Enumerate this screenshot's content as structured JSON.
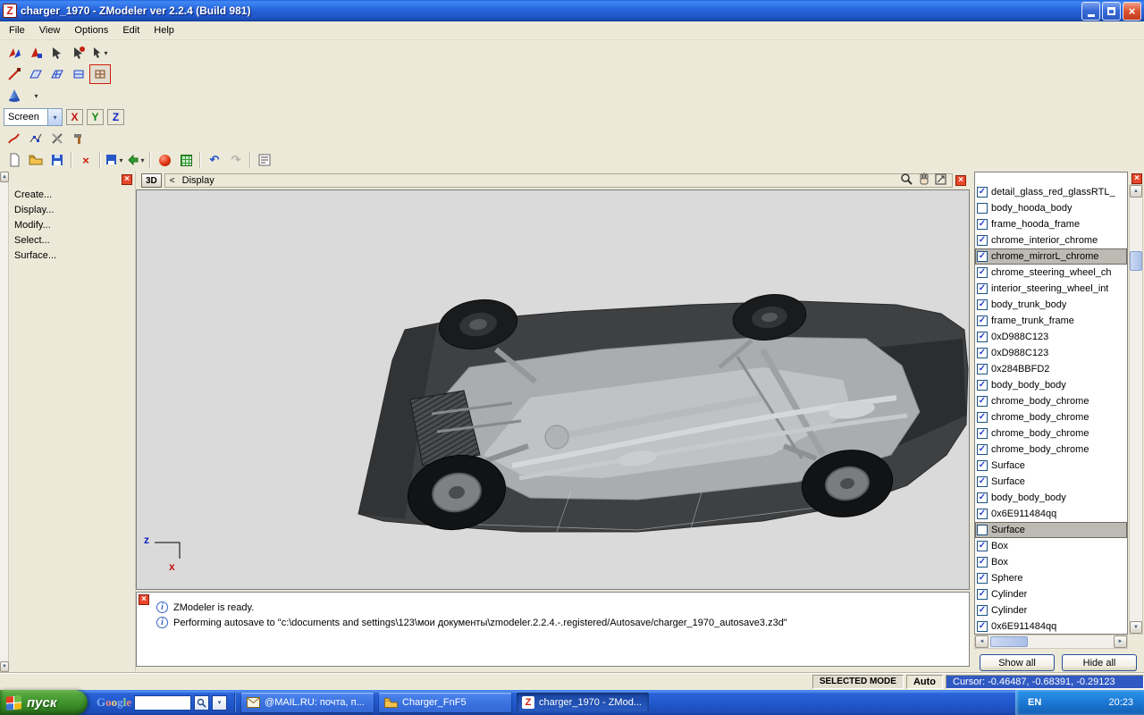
{
  "window": {
    "title": "charger_1970 - ZModeler ver 2.2.4 (Build 981)",
    "app_icon_letter": "Z"
  },
  "glyphs": {
    "close": "×",
    "dropdown": "▾",
    "up": "▲",
    "down": "▼",
    "left": "◄",
    "right": "►",
    "check": "✓",
    "undo": "↶",
    "redo": "↷",
    "info": "i",
    "delete": "×"
  },
  "menu": {
    "items": [
      {
        "label": "File"
      },
      {
        "label": "View"
      },
      {
        "label": "Options"
      },
      {
        "label": "Edit"
      },
      {
        "label": "Help"
      }
    ]
  },
  "toolbar": {
    "space_combo": {
      "value": "Screen"
    },
    "axes": {
      "x": "X",
      "y": "Y",
      "z": "Z"
    }
  },
  "left_panel": {
    "items": [
      {
        "label": "Create..."
      },
      {
        "label": "Display..."
      },
      {
        "label": "Modify..."
      },
      {
        "label": "Select..."
      },
      {
        "label": "Surface..."
      }
    ]
  },
  "viewport": {
    "mode_button": "3D",
    "back": "<",
    "title": "Display",
    "axis": {
      "z": "z",
      "x": "x"
    }
  },
  "right_panel": {
    "show_all": "Show all",
    "hide_all": "Hide all",
    "items": [
      {
        "label": "detail_glass_red_glassRTL_",
        "checked": true,
        "selected": false
      },
      {
        "label": "body_hooda_body",
        "checked": false,
        "selected": false
      },
      {
        "label": "frame_hooda_frame",
        "checked": true,
        "selected": false
      },
      {
        "label": "chrome_interior_chrome",
        "checked": true,
        "selected": false
      },
      {
        "label": "chrome_mirrorL_chrome",
        "checked": true,
        "selected": true
      },
      {
        "label": "chrome_steering_wheel_ch",
        "checked": true,
        "selected": false
      },
      {
        "label": "interior_steering_wheel_int",
        "checked": true,
        "selected": false
      },
      {
        "label": "body_trunk_body",
        "checked": true,
        "selected": false
      },
      {
        "label": "frame_trunk_frame",
        "checked": true,
        "selected": false
      },
      {
        "label": "0xD988C123",
        "checked": true,
        "selected": false
      },
      {
        "label": "0xD988C123",
        "checked": true,
        "selected": false
      },
      {
        "label": "0x284BBFD2",
        "checked": true,
        "selected": false
      },
      {
        "label": "body_body_body",
        "checked": true,
        "selected": false
      },
      {
        "label": "chrome_body_chrome",
        "checked": true,
        "selected": false
      },
      {
        "label": "chrome_body_chrome",
        "checked": true,
        "selected": false
      },
      {
        "label": "chrome_body_chrome",
        "checked": true,
        "selected": false
      },
      {
        "label": "chrome_body_chrome",
        "checked": true,
        "selected": false
      },
      {
        "label": "Surface",
        "checked": true,
        "selected": false
      },
      {
        "label": "Surface",
        "checked": true,
        "selected": false
      },
      {
        "label": "body_body_body",
        "checked": true,
        "selected": false
      },
      {
        "label": "0x6E911484qq",
        "checked": true,
        "selected": false
      },
      {
        "label": "Surface",
        "checked": false,
        "selected": true
      },
      {
        "label": "Box",
        "checked": true,
        "selected": false
      },
      {
        "label": "Box",
        "checked": true,
        "selected": false
      },
      {
        "label": "Sphere",
        "checked": true,
        "selected": false
      },
      {
        "label": "Cylinder",
        "checked": true,
        "selected": false
      },
      {
        "label": "Cylinder",
        "checked": true,
        "selected": false
      },
      {
        "label": "0x6E911484qq",
        "checked": true,
        "selected": false
      }
    ]
  },
  "messages": {
    "lines": [
      {
        "text": "ZModeler is ready."
      },
      {
        "text": "Performing autosave to \"c:\\documents and settings\\123\\мои документы\\zmodeler.2.2.4.-.registered/Autosave/charger_1970_autosave3.z3d\""
      }
    ]
  },
  "status_bar": {
    "selected_mode": "SELECTED MODE",
    "auto_label": "Auto",
    "cursor": "Cursor: -0.46487, -0.68391, -0.29123"
  },
  "taskbar": {
    "start_label": "пуск",
    "search_letters": [
      "G",
      "o",
      "o",
      "g",
      "l",
      "e"
    ],
    "tasks": [
      {
        "label": "@MAIL.RU: почта, п...",
        "active": false
      },
      {
        "label": "Charger_FnF5",
        "active": false
      },
      {
        "label": "charger_1970 - ZMod...",
        "active": true
      }
    ],
    "tray": {
      "language": "EN",
      "time": "20:23"
    }
  }
}
